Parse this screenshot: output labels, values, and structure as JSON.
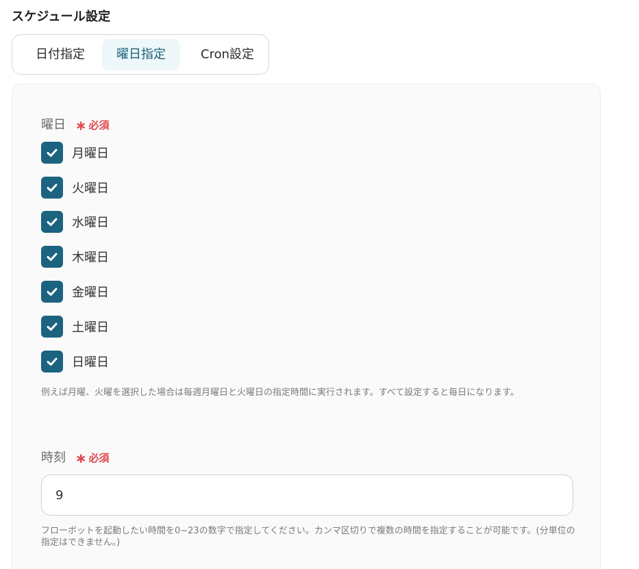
{
  "section_title": "スケジュール設定",
  "tabs": [
    {
      "label": "日付指定",
      "active": false
    },
    {
      "label": "曜日指定",
      "active": true
    },
    {
      "label": "Cron設定",
      "active": false
    }
  ],
  "weekday_field": {
    "label": "曜日",
    "required_label": "必須",
    "options": [
      {
        "label": "月曜日",
        "checked": true
      },
      {
        "label": "火曜日",
        "checked": true
      },
      {
        "label": "水曜日",
        "checked": true
      },
      {
        "label": "木曜日",
        "checked": true
      },
      {
        "label": "金曜日",
        "checked": true
      },
      {
        "label": "土曜日",
        "checked": true
      },
      {
        "label": "日曜日",
        "checked": true
      }
    ],
    "help": "例えば月曜、火曜を選択した場合は毎週月曜日と火曜日の指定時間に実行されます。すべて設定すると毎日になります。"
  },
  "time_field": {
    "label": "時刻",
    "required_label": "必須",
    "value": "9",
    "help": "フローボットを起動したい時間を0~23の数字で指定してください。カンマ区切りで複数の時間を指定することが可能です。(分単位の指定はできません。)"
  },
  "colors": {
    "checkbox": "#1c6380",
    "required": "#e0484e",
    "active_tab_bg": "#eef7f9",
    "active_tab_text": "#1c5f77"
  },
  "icons": {
    "checkbox_check": "check-icon",
    "required_marker": "asterisk-icon"
  }
}
